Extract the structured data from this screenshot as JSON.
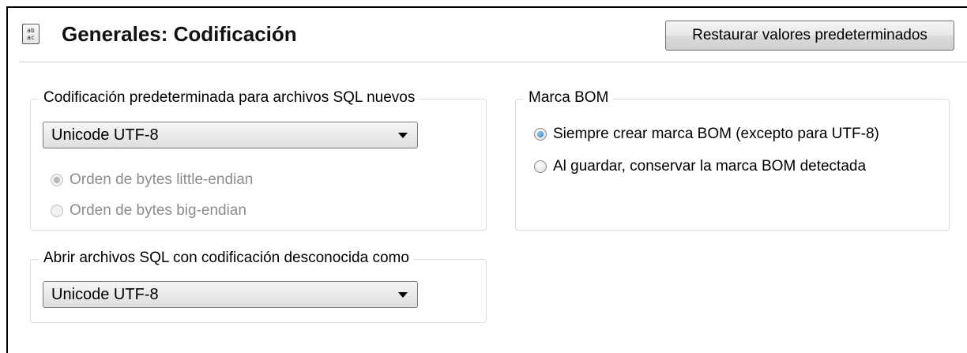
{
  "header": {
    "icon": "encoding-icon",
    "icon_text": "ab\nac",
    "title": "Generales: Codificación",
    "restore_button": "Restaurar valores predeterminados"
  },
  "new_sql_encoding": {
    "legend": "Codificación predeterminada para archivos SQL nuevos",
    "selected": "Unicode UTF-8",
    "byte_order": [
      {
        "label": "Orden de bytes little-endian",
        "checked": true,
        "enabled": false
      },
      {
        "label": "Orden de bytes big-endian",
        "checked": false,
        "enabled": false
      }
    ]
  },
  "unknown_encoding": {
    "legend": "Abrir archivos SQL con codificación desconocida como",
    "selected": "Unicode UTF-8"
  },
  "bom": {
    "legend": "Marca BOM",
    "options": [
      {
        "label": "Siempre crear marca BOM (excepto para UTF-8)",
        "checked": true,
        "enabled": true
      },
      {
        "label": "Al guardar, conservar la marca BOM detectada",
        "checked": false,
        "enabled": true
      }
    ]
  }
}
